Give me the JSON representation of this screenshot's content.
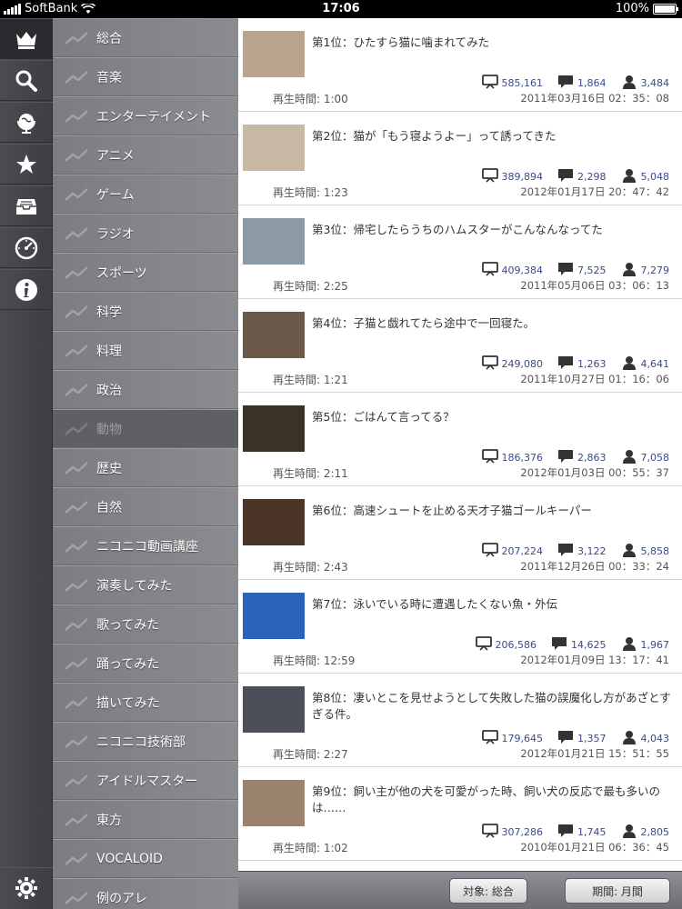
{
  "status": {
    "carrier": "SoftBank",
    "time": "17:06",
    "battery": "100%"
  },
  "rail": [
    "crown-icon",
    "search-icon",
    "globe-icon",
    "star-icon",
    "inbox-icon",
    "gauge-icon",
    "info-icon",
    "gear-icon"
  ],
  "categories": [
    "総合",
    "音楽",
    "エンターテイメント",
    "アニメ",
    "ゲーム",
    "ラジオ",
    "スポーツ",
    "科学",
    "料理",
    "政治",
    "動物",
    "歴史",
    "自然",
    "ニコニコ動画講座",
    "演奏してみた",
    "歌ってみた",
    "踊ってみた",
    "描いてみた",
    "ニコニコ技術部",
    "アイドルマスター",
    "東方",
    "VOCALOID",
    "例のアレ"
  ],
  "active_category": "動物",
  "items": [
    {
      "title": "第1位：ひたすら猫に噛まれてみた",
      "views": "585,161",
      "comments": "1,864",
      "mylists": "3,484",
      "duration": "再生時間: 1:00",
      "date": "2011年03月16日 02：35：08",
      "thumb": "#b9a58d"
    },
    {
      "title": "第2位：猫が「もう寝ようよー」って誘ってきた",
      "views": "389,894",
      "comments": "2,298",
      "mylists": "5,048",
      "duration": "再生時間: 1:23",
      "date": "2012年01月17日 20：47：42",
      "thumb": "#c7b9a3"
    },
    {
      "title": "第3位：帰宅したらうちのハムスターがこんなんなってた",
      "views": "409,384",
      "comments": "7,525",
      "mylists": "7,279",
      "duration": "再生時間: 2:25",
      "date": "2011年05月06日 03：06：13",
      "thumb": "#8c9aa6"
    },
    {
      "title": "第4位：子猫と戯れてたら途中で一回寝た。",
      "views": "249,080",
      "comments": "1,263",
      "mylists": "4,641",
      "duration": "再生時間: 1:21",
      "date": "2011年10月27日 01：16：06",
      "thumb": "#6b5a4a"
    },
    {
      "title": "第5位：ごはんて言ってる？",
      "views": "186,376",
      "comments": "2,863",
      "mylists": "7,058",
      "duration": "再生時間: 2:11",
      "date": "2012年01月03日 00：55：37",
      "thumb": "#3a3225"
    },
    {
      "title": "第6位：高速シュートを止める天才子猫ゴールキーパー",
      "views": "207,224",
      "comments": "3,122",
      "mylists": "5,858",
      "duration": "再生時間: 2:43",
      "date": "2011年12月26日 00：33：24",
      "thumb": "#4b3526"
    },
    {
      "title": "第7位：泳いでいる時に遭遇したくない魚・外伝",
      "views": "206,586",
      "comments": "14,625",
      "mylists": "1,967",
      "duration": "再生時間: 12:59",
      "date": "2012年01月09日 13：17：41",
      "thumb": "#2a63b8"
    },
    {
      "title": "第8位：凄いとこを見せようとして失敗した猫の誤魔化し方があざとすぎる件。",
      "views": "179,645",
      "comments": "1,357",
      "mylists": "4,043",
      "duration": "再生時間: 2:27",
      "date": "2012年01月21日 15：51：55",
      "thumb": "#4a4f5a"
    },
    {
      "title": "第9位：飼い主が他の犬を可愛がった時、飼い犬の反応で最も多いのは……",
      "views": "307,286",
      "comments": "1,745",
      "mylists": "2,805",
      "duration": "再生時間: 1:02",
      "date": "2010年01月21日 06：36：45",
      "thumb": "#9a8470"
    }
  ],
  "toolbar": {
    "target": "対象: 総合",
    "period": "期間: 月間"
  }
}
